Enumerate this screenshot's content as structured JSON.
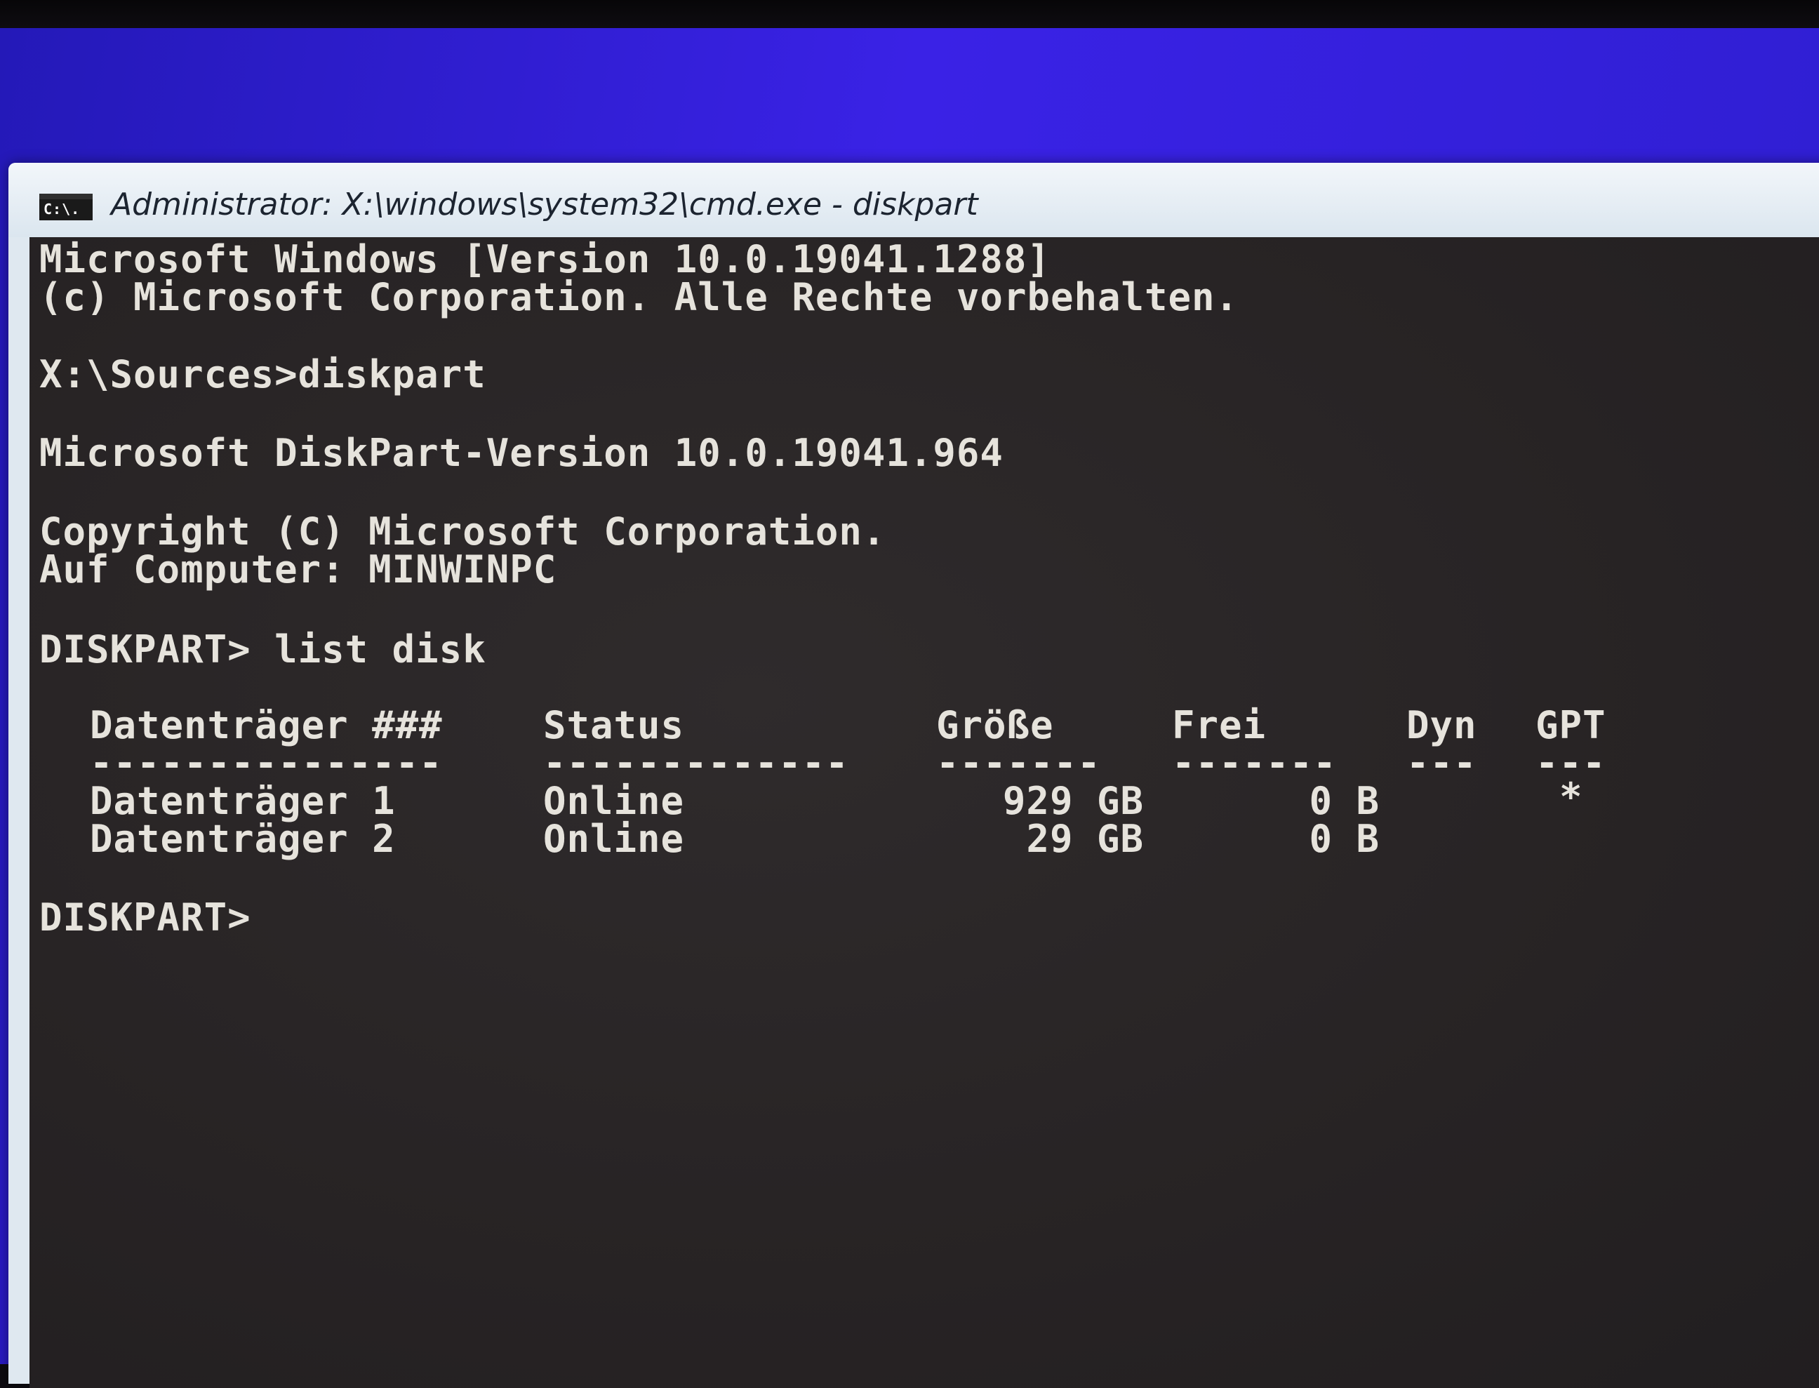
{
  "window": {
    "title": "Administrator: X:\\windows\\system32\\cmd.exe - diskpart",
    "icon": "cmd-icon",
    "icon_glyph": "C:\\."
  },
  "console": {
    "lines": [
      "Microsoft Windows [Version 10.0.19041.1288]",
      "(c) Microsoft Corporation. Alle Rechte vorbehalten.",
      "X:\\Sources>diskpart",
      "Microsoft DiskPart-Version 10.0.19041.964",
      "Copyright (C) Microsoft Corporation.",
      "Auf Computer: MINWINPC",
      "DISKPART> list disk"
    ],
    "table": {
      "headers": [
        "Datenträger ###",
        "Status",
        "Größe",
        "Frei",
        "Dyn",
        "GPT"
      ],
      "separators": [
        "---------------",
        "-------------",
        "-------",
        "-------",
        "---",
        "---"
      ],
      "rows": [
        [
          "Datenträger 1",
          "Online",
          "929 GB",
          "0 B",
          "",
          "*"
        ],
        [
          "Datenträger 2",
          "Online",
          "29 GB",
          "0 B",
          "",
          ""
        ]
      ]
    },
    "prompt": "DISKPART>"
  }
}
